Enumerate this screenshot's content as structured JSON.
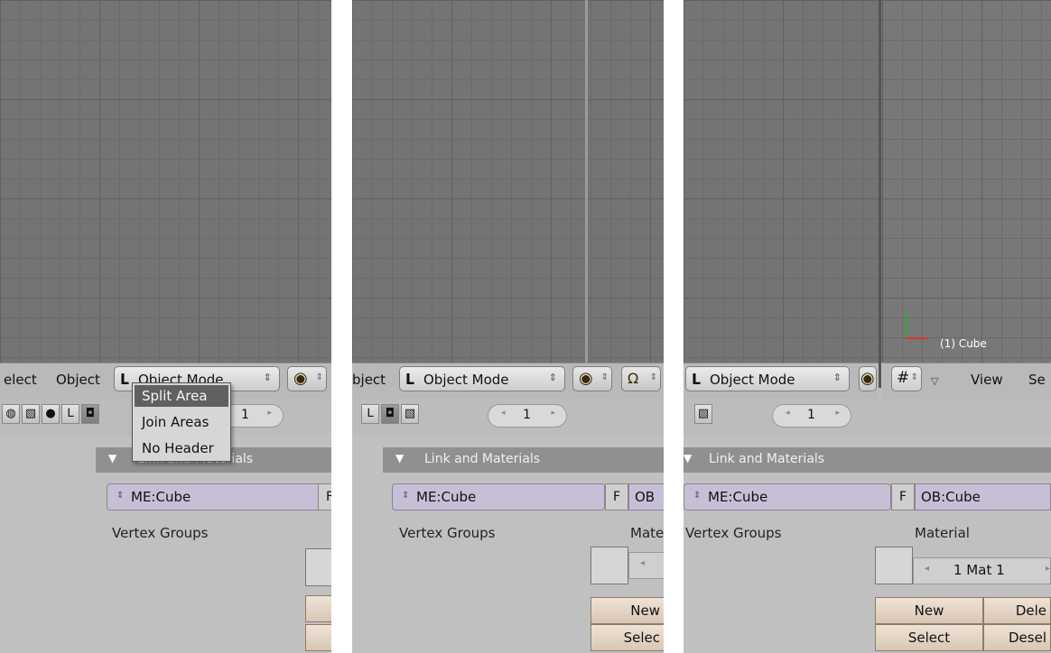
{
  "panel1": {
    "menu_select": "elect",
    "menu_object": "Object",
    "mode": "Object Mode",
    "frame": "1",
    "panel_title": "Link and Materials",
    "mesh": "ME:Cube",
    "mesh_f": "F",
    "vertex_groups": "Vertex Groups"
  },
  "popup": {
    "items": [
      "Split Area",
      "Join Areas",
      "No Header"
    ]
  },
  "panel2": {
    "menu_object": "bject",
    "mode": "Object Mode",
    "frame": "1",
    "panel_title": "Link and Materials",
    "mesh": "ME:Cube",
    "mesh_f": "F",
    "ob": "OB",
    "vertex_groups": "Vertex Groups",
    "material": "Mate",
    "new": "New",
    "select": "Selec"
  },
  "panel3": {
    "mode": "Object Mode",
    "view": "View",
    "select_cut": "Se",
    "frame": "1",
    "panel_title": "Link and Materials",
    "mesh": "ME:Cube",
    "mesh_f": "F",
    "ob": "OB:Cube",
    "vertex_groups": "Vertex Groups",
    "material": "Material",
    "mat_value": "1 Mat 1",
    "new": "New",
    "delete": "Dele",
    "select": "Select",
    "deselect": "Desel",
    "cube_label": "(1) Cube"
  },
  "colors": {
    "viewport": "#747474",
    "highlight": "#606060",
    "mesh_field": "#c7bfd6"
  },
  "icons": [
    "object-mode-icon",
    "shading-icon",
    "pivot-icon",
    "grid-icon",
    "arrow-left-icon",
    "arrow-right-icon"
  ]
}
